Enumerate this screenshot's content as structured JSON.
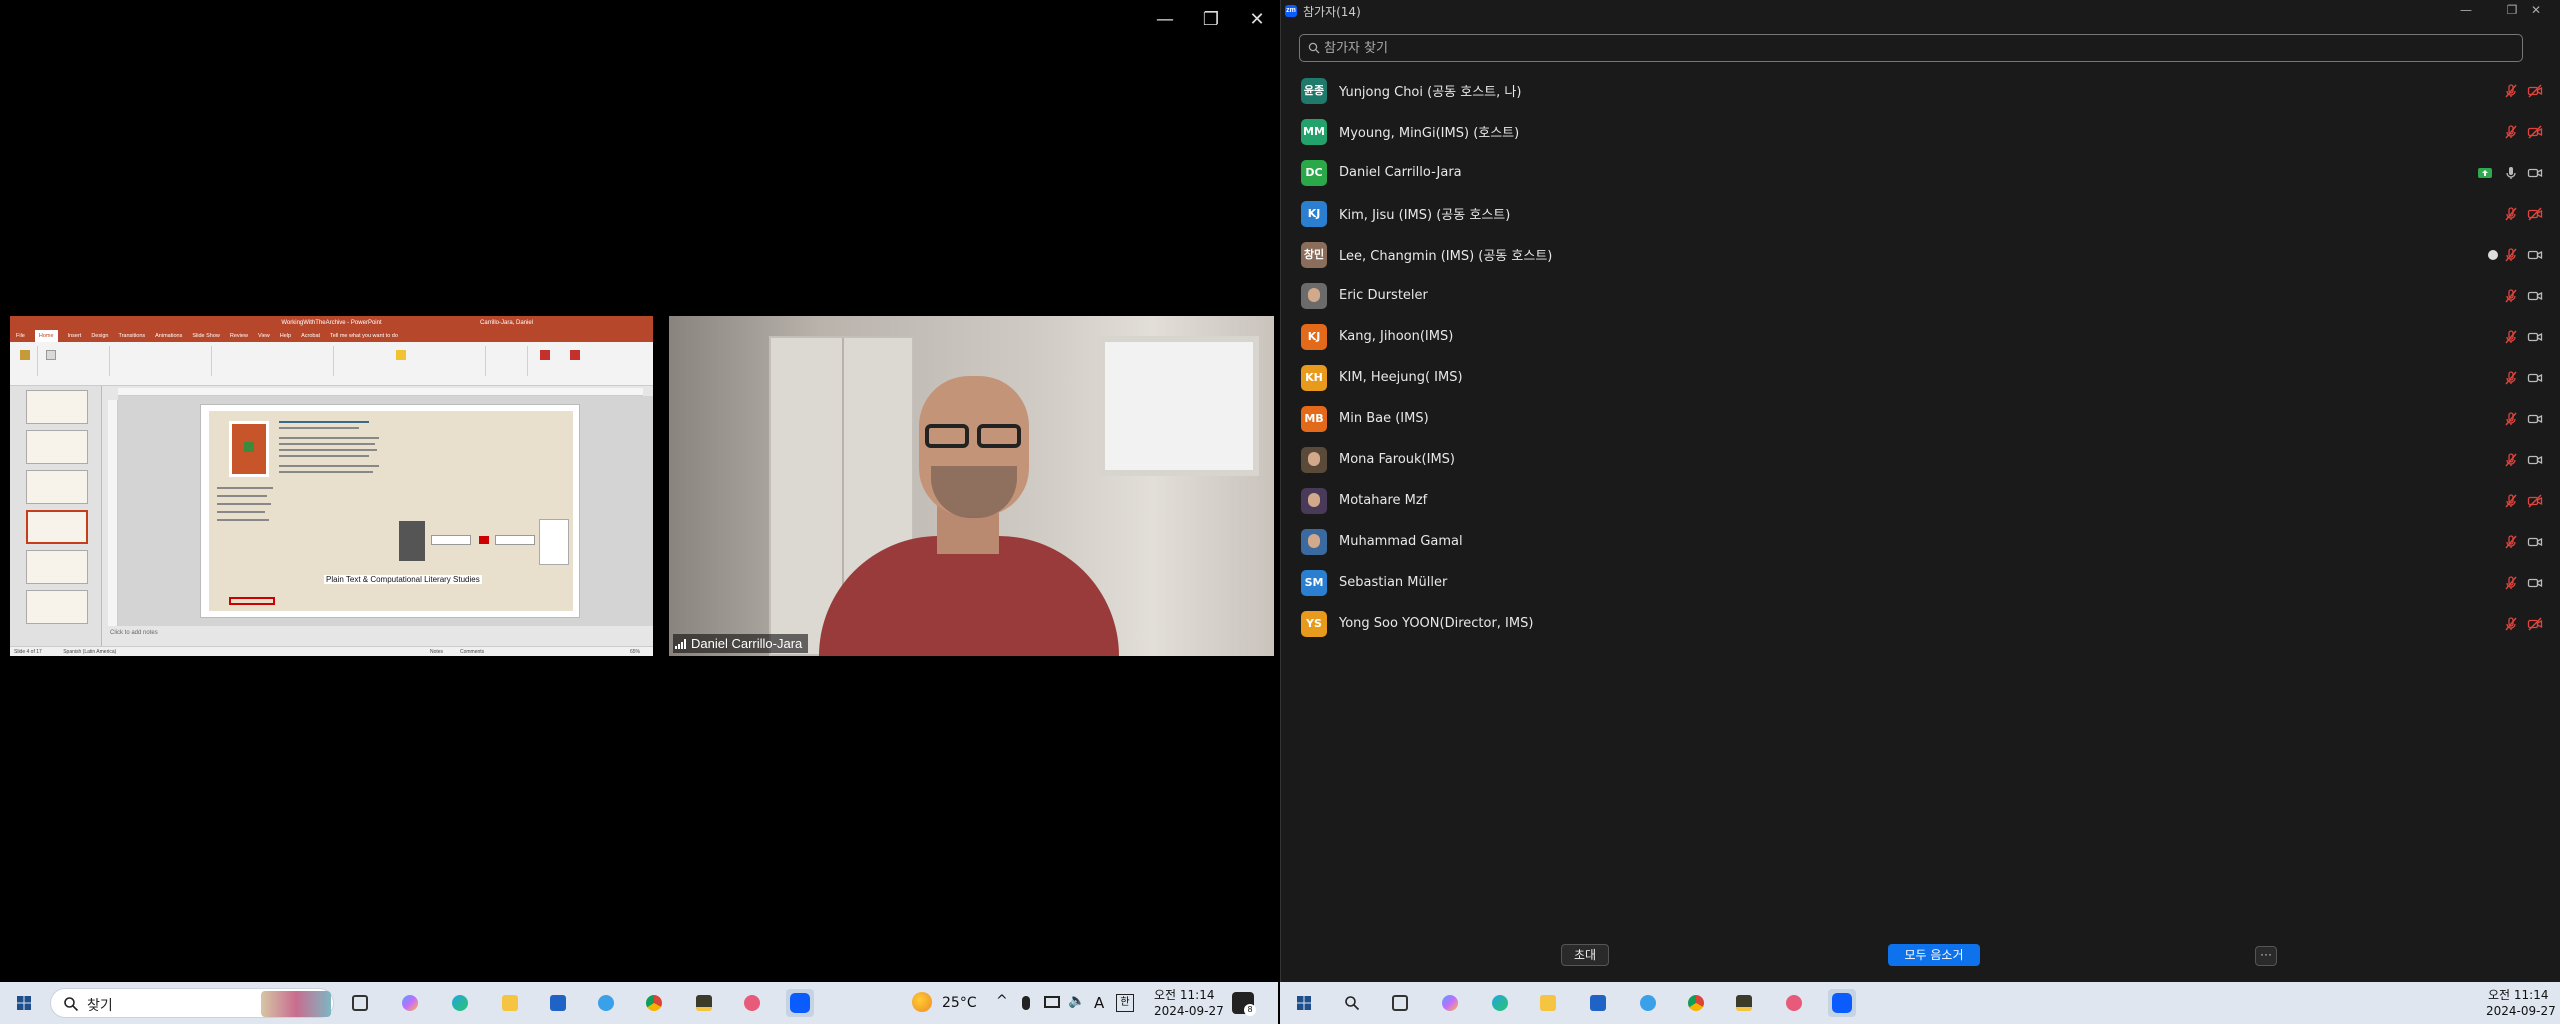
{
  "gallery": {
    "window_controls": {
      "minimize": "—",
      "restore": "❐",
      "close": "✕"
    },
    "shared_screen": {
      "app_title": "WorkingWithTheArchive - PowerPoint",
      "user": "Carrillo-Jara, Daniel",
      "tabs": [
        "File",
        "Home",
        "Insert",
        "Design",
        "Transitions",
        "Animations",
        "Slide Show",
        "Review",
        "View",
        "Help",
        "Acrobat",
        "Tell me what you want to do"
      ],
      "slide_callout": "Plain Text & Computational Literary Studies",
      "notes_placeholder": "Click to add notes",
      "status_left": "Slide 4 of 17",
      "status_lang": "Spanish (Latin America)",
      "status_notes": "Notes",
      "status_comments": "Comments",
      "zoom": "65%"
    },
    "camera": {
      "participant_name": "Daniel Carrillo-Jara"
    }
  },
  "panel": {
    "title": "참가자(14)",
    "window_controls": {
      "minimize": "—",
      "restore": "❐",
      "close": "✕"
    },
    "search_placeholder": "참가자 찾기",
    "participants": [
      {
        "initials": "윤종",
        "name": "Yunjong Choi (공동 호스트, 나)",
        "avatar_color": "#1f7a6b",
        "mic": "muted",
        "video": "off"
      },
      {
        "initials": "MM",
        "name": "Myoung, MinGi(IMS) (호스트)",
        "avatar_color": "#23a36b",
        "mic": "muted",
        "video": "off"
      },
      {
        "initials": "DC",
        "name": "Daniel Carrillo-Jara",
        "avatar_color": "#2aa84a",
        "mic": "on",
        "video": "on",
        "sharing": true
      },
      {
        "initials": "KJ",
        "name": "Kim, Jisu (IMS) (공동 호스트)",
        "avatar_color": "#2b7fd1",
        "mic": "muted",
        "video": "off"
      },
      {
        "initials": "창민",
        "name": "Lee, Changmin (IMS) (공동 호스트)",
        "avatar_color": "#8a6d5a",
        "mic": "muted",
        "video": "on",
        "recording": true
      },
      {
        "initials": "",
        "name": "Eric Dursteler",
        "avatar_color": "#6b6b6b",
        "photo": true,
        "mic": "muted",
        "video": "on"
      },
      {
        "initials": "KJ",
        "name": "Kang, Jihoon(IMS)",
        "avatar_color": "#e36a1a",
        "mic": "muted",
        "video": "on"
      },
      {
        "initials": "KH",
        "name": "KIM, Heejung( IMS)",
        "avatar_color": "#e89a1c",
        "mic": "muted",
        "video": "on"
      },
      {
        "initials": "MB",
        "name": "Min Bae (IMS)",
        "avatar_color": "#e36a1a",
        "mic": "muted",
        "video": "on"
      },
      {
        "initials": "",
        "name": "Mona Farouk(IMS)",
        "avatar_color": "#5a4a3a",
        "photo": true,
        "mic": "muted",
        "video": "on"
      },
      {
        "initials": "",
        "name": "Motahare Mzf",
        "avatar_color": "#4a3a5a",
        "photo": true,
        "mic": "muted",
        "video": "off"
      },
      {
        "initials": "",
        "name": "Muhammad Gamal",
        "avatar_color": "#3a6aa0",
        "photo": true,
        "mic": "muted",
        "video": "on"
      },
      {
        "initials": "SM",
        "name": "Sebastian Müller",
        "avatar_color": "#2b7fd1",
        "mic": "muted",
        "video": "on"
      },
      {
        "initials": "YS",
        "name": "Yong Soo YOON(Director, IMS)",
        "avatar_color": "#e89a1c",
        "mic": "muted",
        "video": "off"
      }
    ],
    "invite_label": "초대",
    "mute_all_label": "모두 음소거",
    "more_label": "···"
  },
  "taskbar_left": {
    "search_label": "찾기",
    "weather": "25°C",
    "time": "오전 11:14",
    "date": "2024-09-27",
    "notification_count": "8",
    "ime": "A"
  },
  "taskbar_right": {
    "time": "오전 11:14",
    "date": "2024-09-27"
  },
  "colors": {
    "accent": "#0e72ed",
    "muted_red": "#e0443e",
    "ppt_red": "#b7472a",
    "zoom_blue": "#0b5cff"
  }
}
